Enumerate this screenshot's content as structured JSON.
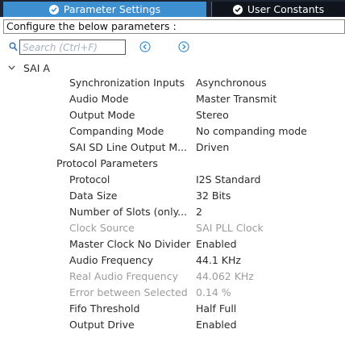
{
  "tabs": [
    {
      "label": "Parameter Settings",
      "active": true
    },
    {
      "label": "User Constants",
      "active": false
    }
  ],
  "header": {
    "text": "Configure the below parameters :"
  },
  "search": {
    "placeholder": "Search (Ctrl+F)"
  },
  "tree": {
    "root_label": "SAI A",
    "general": [
      {
        "label": "Synchronization Inputs",
        "value": "Asynchronous",
        "disabled": false
      },
      {
        "label": "Audio Mode",
        "value": "Master Transmit",
        "disabled": false
      },
      {
        "label": "Output Mode",
        "value": "Stereo",
        "disabled": false
      },
      {
        "label": "Companding Mode",
        "value": "No companding mode",
        "disabled": false
      },
      {
        "label": "SAI SD Line Output M...",
        "value": "Driven",
        "disabled": false
      }
    ],
    "group_label": "Protocol Parameters",
    "protocol": [
      {
        "label": "Protocol",
        "value": "I2S Standard",
        "disabled": false
      },
      {
        "label": "Data Size",
        "value": "32 Bits",
        "disabled": false
      },
      {
        "label": "Number of Slots (only...",
        "value": "2",
        "disabled": false
      },
      {
        "label": "Clock Source",
        "value": "SAI PLL Clock",
        "disabled": true
      },
      {
        "label": "Master Clock No Divider",
        "value": "Enabled",
        "disabled": false
      },
      {
        "label": "Audio Frequency",
        "value": "44.1 KHz",
        "disabled": false
      },
      {
        "label": "Real Audio Frequency",
        "value": "44.062 KHz",
        "disabled": true
      },
      {
        "label": "Error between Selected",
        "value": "0.14 %",
        "disabled": true
      },
      {
        "label": "Fifo Threshold",
        "value": "Half Full",
        "disabled": false
      },
      {
        "label": "Output Drive",
        "value": "Enabled",
        "disabled": false
      }
    ]
  },
  "colors": {
    "tab_active": "#3d8fd0",
    "tab_bar": "#1d2433",
    "nav_button": "#3d8fd0",
    "disabled_text": "#9c9c9c"
  }
}
